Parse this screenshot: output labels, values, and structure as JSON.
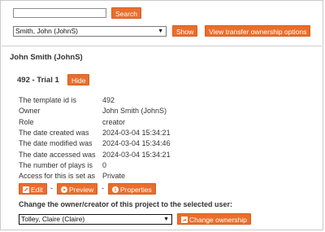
{
  "search": {
    "value": "",
    "button_label": "Search"
  },
  "user_select": {
    "selected": "Smith, John (JohnS)",
    "show_label": "Show",
    "transfer_label": "View transfer ownership options"
  },
  "user_heading": "John Smith (JohnS)",
  "template": {
    "title": "492 - Trial 1",
    "hide_label": "Hide"
  },
  "details": [
    {
      "label": "The template id is",
      "value": "492"
    },
    {
      "label": "Owner",
      "value": "John Smith (JohnS)"
    },
    {
      "label": "Role",
      "value": "creator"
    },
    {
      "label": "The date created was",
      "value": "2024-03-04 15:34:21"
    },
    {
      "label": "The date modified was",
      "value": "2024-03-04 15:34:46"
    },
    {
      "label": "The date accessed was",
      "value": "2024-03-04 15:34:21"
    },
    {
      "label": "The number of plays is",
      "value": "0"
    },
    {
      "label": "Access for this is set as",
      "value": "Private"
    }
  ],
  "actions": {
    "edit": "Edit",
    "preview": "Preview",
    "properties": "Properties",
    "separator": "-"
  },
  "change_owner": {
    "prompt": "Change the owner/creator of this project to the selected user:",
    "selected_user": "Tolley, Claire (Claire)",
    "button_label": "Change ownership"
  },
  "colors": {
    "accent": "#ea6e2c",
    "border": "#c9c9c9"
  }
}
